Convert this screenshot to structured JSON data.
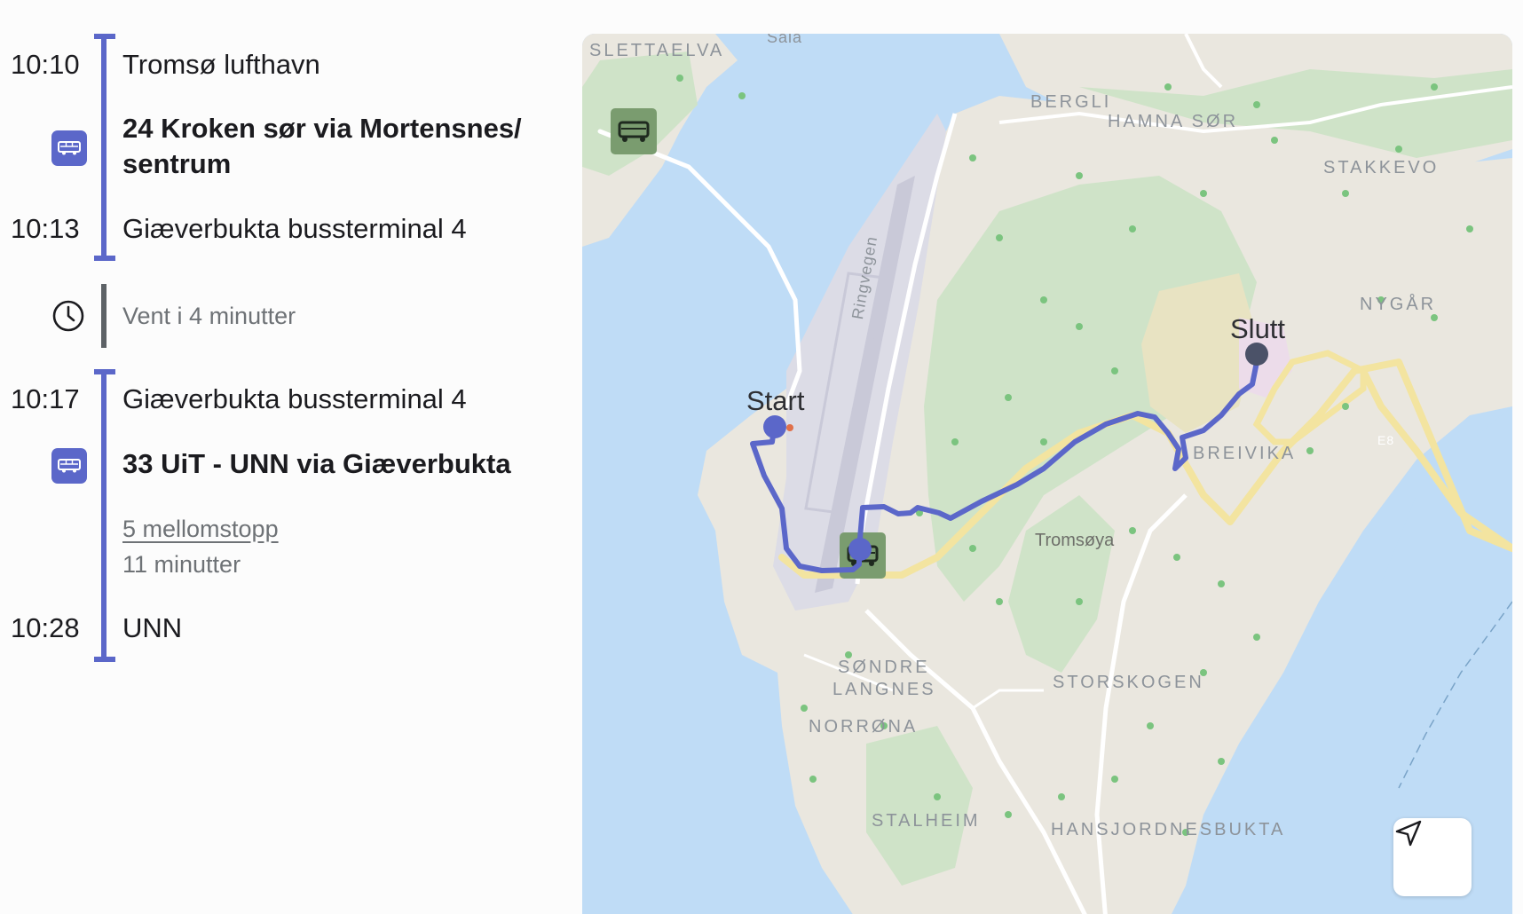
{
  "itinerary": {
    "leg1": {
      "dep_time": "10:10",
      "from": "Tromsø lufthavn",
      "line": "24 Kroken sør via Mortensnes/ sentrum",
      "arr_time": "10:13",
      "to": "Giæverbukta bussterminal 4",
      "mode_icon": "bus-icon",
      "color": "#5b67c9"
    },
    "wait": {
      "text": "Vent i 4 minutter",
      "icon": "clock-icon",
      "color": "#5d6266"
    },
    "leg2": {
      "dep_time": "10:17",
      "from": "Giæverbukta bussterminal 4",
      "line": "33 UiT - UNN via Giæverbukta",
      "intermediate_stops": "5 mellomstopp",
      "duration": "11 minutter",
      "arr_time": "10:28",
      "to": "UNN",
      "mode_icon": "bus-icon",
      "color": "#5b67c9"
    }
  },
  "map": {
    "start_label": "Start",
    "end_label": "Slutt",
    "labels": {
      "slettaelva": "SLETTAELVA",
      "sala": "Sala",
      "bergli": "BERGLI",
      "hamna_sor": "HAMNA SØR",
      "stakkevo": "STAKKEVO",
      "nygar": "NYGÅR",
      "ringvegen": "Ringvegen",
      "breivika": "BREIVIKA",
      "e8": "E8",
      "tromsoya": "Tromsøya",
      "sondre": "SØNDRE",
      "langnes": "LANGNES",
      "storskogen": "STORSKOGEN",
      "norrona": "NORRØNA",
      "stalheim": "STALHEIM",
      "hans_bukta": "HANSJORDNESBUKTA"
    },
    "route_color": "#5b67c9",
    "locate_icon": "navigation-arrow-icon"
  }
}
